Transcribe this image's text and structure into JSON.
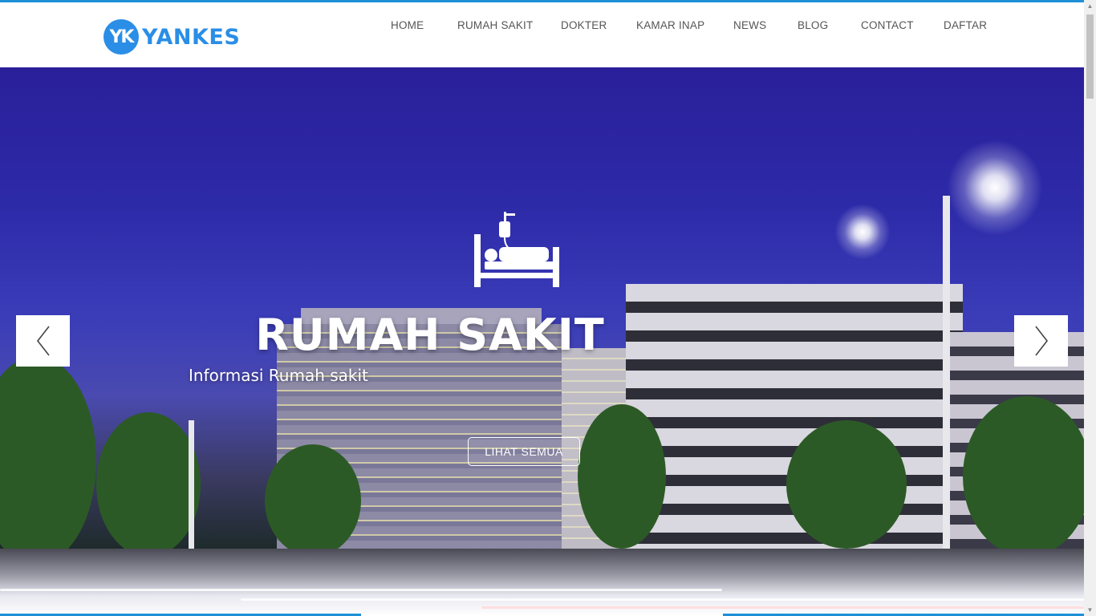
{
  "brand": {
    "logo_mark": "YK",
    "name": "YANKES",
    "color": "#2a8ee6"
  },
  "nav": {
    "items": [
      {
        "label": "HOME"
      },
      {
        "label": "RUMAH SAKIT"
      },
      {
        "label": "DOKTER"
      },
      {
        "label": "KAMAR INAP"
      },
      {
        "label": "NEWS"
      },
      {
        "label": "BLOG"
      },
      {
        "label": "CONTACT"
      },
      {
        "label": "DAFTAR"
      }
    ]
  },
  "hero": {
    "icon": "hospital-bed-icon",
    "title": "RUMAH SAKIT",
    "subtitle": "Informasi Rumah sakit",
    "button_label": "LIHAT SEMUA",
    "prev_icon": "chevron-left-icon",
    "next_icon": "chevron-right-icon"
  },
  "colors": {
    "accent": "#1e90d8"
  }
}
